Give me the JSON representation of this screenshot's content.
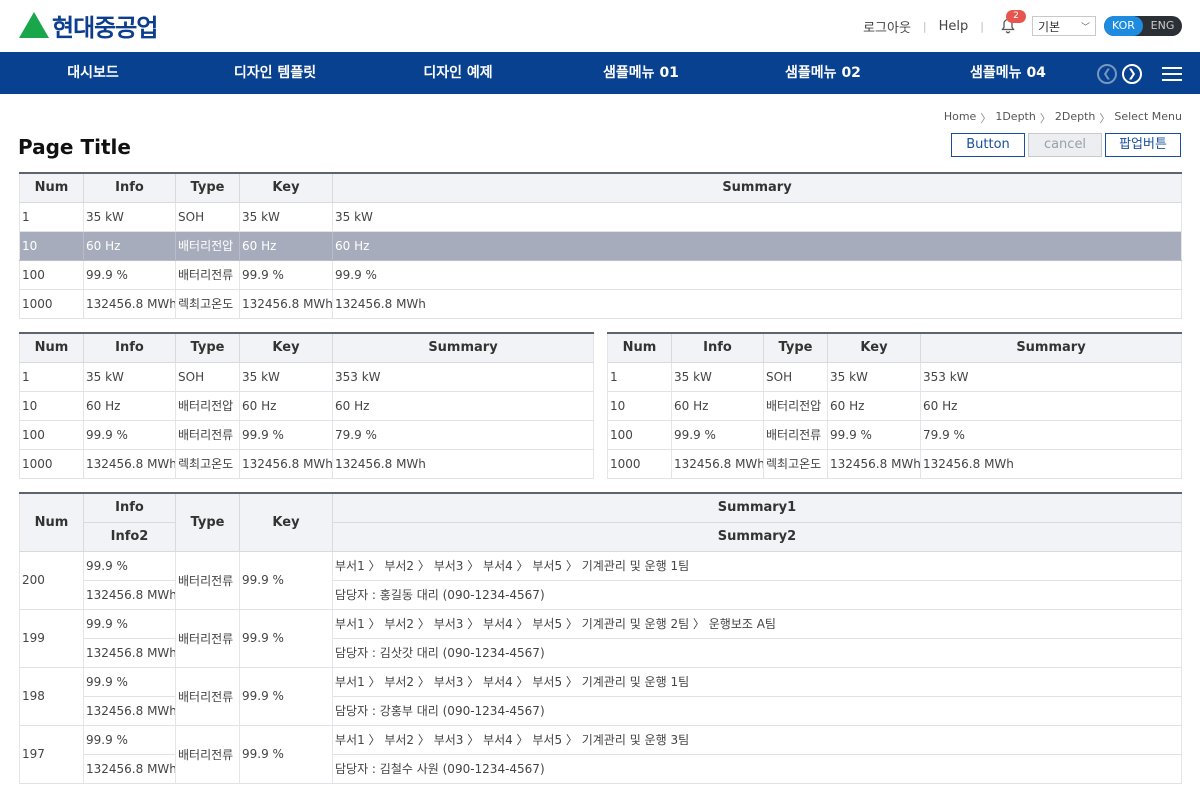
{
  "header": {
    "brand": "현대중공업",
    "logout": "로그아웃",
    "help": "Help",
    "notification_count": "2",
    "view_select": "기본",
    "lang_kor": "KOR",
    "lang_eng": "ENG"
  },
  "nav": {
    "items": [
      "대시보드",
      "디자인 템플릿",
      "디자인 예제",
      "샘플메뉴 01",
      "샘플메뉴 02",
      "샘플메뉴 04"
    ]
  },
  "breadcrumb": [
    "Home",
    "1Depth",
    "2Depth",
    "Select Menu"
  ],
  "page": {
    "title": "Page Title",
    "button_label": "Button",
    "cancel_label": "cancel",
    "popup_label": "팝업버튼"
  },
  "columns": {
    "num": "Num",
    "info": "Info",
    "type": "Type",
    "key": "Key",
    "summary": "Summary"
  },
  "table1": [
    [
      "1",
      "35 kW",
      "SOH",
      "35 kW",
      "35 kW"
    ],
    [
      "10",
      "60 Hz",
      "배터리전압",
      "60 Hz",
      "60 Hz"
    ],
    [
      "100",
      "99.9 %",
      "배터리전류",
      "99.9 %",
      "99.9 %"
    ],
    [
      "1000",
      "132456.8 MWh",
      "렉최고온도",
      "132456.8 MWh",
      "132456.8 MWh"
    ]
  ],
  "table2": [
    [
      "1",
      "35 kW",
      "SOH",
      "35 kW",
      "353 kW"
    ],
    [
      "10",
      "60 Hz",
      "배터리전압",
      "60 Hz",
      "60 Hz"
    ],
    [
      "100",
      "99.9 %",
      "배터리전류",
      "99.9 %",
      "79.9 %"
    ],
    [
      "1000",
      "132456.8 MWh",
      "렉최고온도",
      "132456.8 MWh",
      "132456.8 MWh"
    ]
  ],
  "table3": [
    [
      "1",
      "35 kW",
      "SOH",
      "35 kW",
      "353 kW"
    ],
    [
      "10",
      "60 Hz",
      "배터리전압",
      "60 Hz",
      "60 Hz"
    ],
    [
      "100",
      "99.9 %",
      "배터리전류",
      "99.9 %",
      "79.9 %"
    ],
    [
      "1000",
      "132456.8 MWh",
      "렉최고온도",
      "132456.8 MWh",
      "132456.8 MWh"
    ]
  ],
  "table4": {
    "headers": {
      "num": "Num",
      "info": "Info",
      "info2": "Info2",
      "type": "Type",
      "key": "Key",
      "summary1": "Summary1",
      "summary2": "Summary2"
    },
    "rows": [
      {
        "num": "200",
        "info": "99.9 %",
        "info2": "132456.8 MWh",
        "type": "배터리전류",
        "key": "99.9 %",
        "summary1": "부서1 〉 부서2 〉 부서3 〉 부서4 〉 부서5 〉 기계관리 및 운행 1팀",
        "summary2": "담당자 : 홍길동 대리 (090-1234-4567)"
      },
      {
        "num": "199",
        "info": "99.9 %",
        "info2": "132456.8 MWh",
        "type": "배터리전류",
        "key": "99.9 %",
        "summary1": "부서1 〉 부서2 〉 부서3 〉 부서4 〉 부서5 〉 기계관리 및 운행 2팀 〉 운행보조 A팀",
        "summary2": "담당자 : 김삿갓 대리 (090-1234-4567)"
      },
      {
        "num": "198",
        "info": "99.9 %",
        "info2": "132456.8 MWh",
        "type": "배터리전류",
        "key": "99.9 %",
        "summary1": "부서1 〉 부서2 〉 부서3 〉 부서4 〉 부서5 〉 기계관리 및 운행 1팀",
        "summary2": "담당자 : 강홍부 대리 (090-1234-4567)"
      },
      {
        "num": "197",
        "info": "99.9 %",
        "info2": "132456.8 MWh",
        "type": "배터리전류",
        "key": "99.9 %",
        "summary1": "부서1 〉 부서2 〉 부서3 〉 부서4 〉 부서5 〉 기계관리 및 운행 3팀",
        "summary2": "담당자 : 김철수 사원 (090-1234-4567)"
      }
    ]
  },
  "colors": {
    "nav_bg": "#07418f",
    "selected_row": "#a6acbb",
    "brand_text": "#0c3d8f",
    "logo_green": "#1aa64a"
  }
}
